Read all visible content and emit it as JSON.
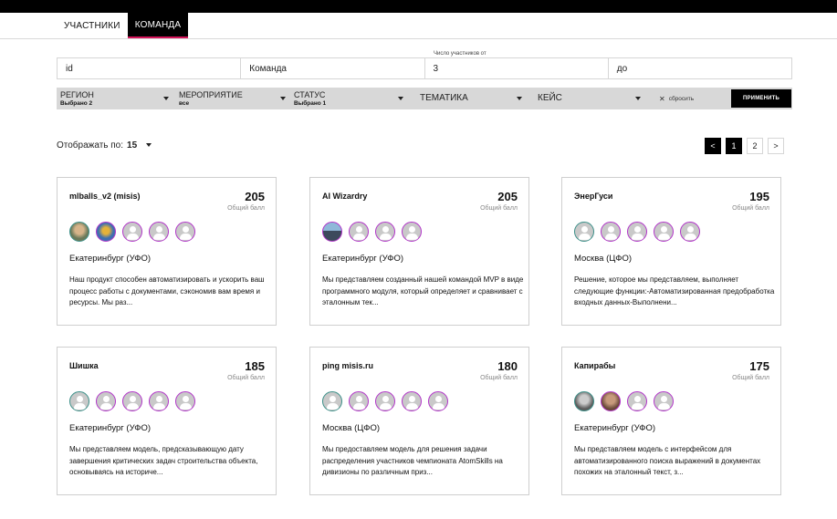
{
  "tabs": [
    {
      "label": "УЧАСТНИКИ",
      "active": false
    },
    {
      "label": "КОМАНДА",
      "active": true
    }
  ],
  "filters_inputs": {
    "id_placeholder": "id",
    "team_placeholder": "Команда",
    "members_from_caption": "Число участников от",
    "members_from_value": "3",
    "members_to_placeholder": "до"
  },
  "filter_bar": {
    "region": {
      "label": "РЕГИОН",
      "value": "Выбрано 2"
    },
    "event": {
      "label": "МЕРОПРИЯТИЕ",
      "value": "все"
    },
    "status": {
      "label": "СТАТУС",
      "value": "Выбрано 1"
    },
    "topic": {
      "label": "ТЕМАТИКА"
    },
    "case": {
      "label": "КЕЙС"
    },
    "reset_label": "сбросить",
    "reset_icon": "close-icon",
    "apply_label": "ПРИМЕНИТЬ"
  },
  "per_page": {
    "label": "Отображать по:",
    "value": "15"
  },
  "pagination": {
    "prev": "<",
    "pages": [
      "1",
      "2"
    ],
    "current": "1",
    "next": ">"
  },
  "score_label": "Общий балл",
  "teams": [
    {
      "name": "mlballs_v2 (misis)",
      "score": "205",
      "region": "Екатеринбург (УФО)",
      "description": "Наш продукт способен автоматизировать и ускорить ваш процесс работы с документами, сэкономив вам время и ресурсы. Мы раз..."
    },
    {
      "name": "AI Wizardry",
      "score": "205",
      "region": "Екатеринбург (УФО)",
      "description": "Мы представляем созданный нашей командой MVP в виде программного модуля, который определяет и сравнивает с эталонным тек..."
    },
    {
      "name": "ЭнерГуси",
      "score": "195",
      "region": "Москва (ЦФО)",
      "description": "Решение, которое мы представляем, выполняет следующие функции:-Автоматизированная предобработка входных данных-Выполнени..."
    },
    {
      "name": "Шишка",
      "score": "185",
      "region": "Екатеринбург (УФО)",
      "description": "Мы представляем модель, предсказывающую дату завершения критических задач строительства объекта, основываясь на историче..."
    },
    {
      "name": "ping misis.ru",
      "score": "180",
      "region": "Москва (ЦФО)",
      "description": "Мы предоставляем модель для решения задачи распределения участников чемпионата AtomSkills на дивизионы по различным приз..."
    },
    {
      "name": "Капирабы",
      "score": "175",
      "region": "Екатеринбург (УФО)",
      "description": "Мы представляем модель с интерфейсом для автоматизированного поиска выражений в документах похожих на эталонный текст, з..."
    }
  ],
  "colors": {
    "accent": "#d4145a",
    "avatar_border": "#b235c9",
    "avatar_border_alt": "#3b8f88"
  }
}
